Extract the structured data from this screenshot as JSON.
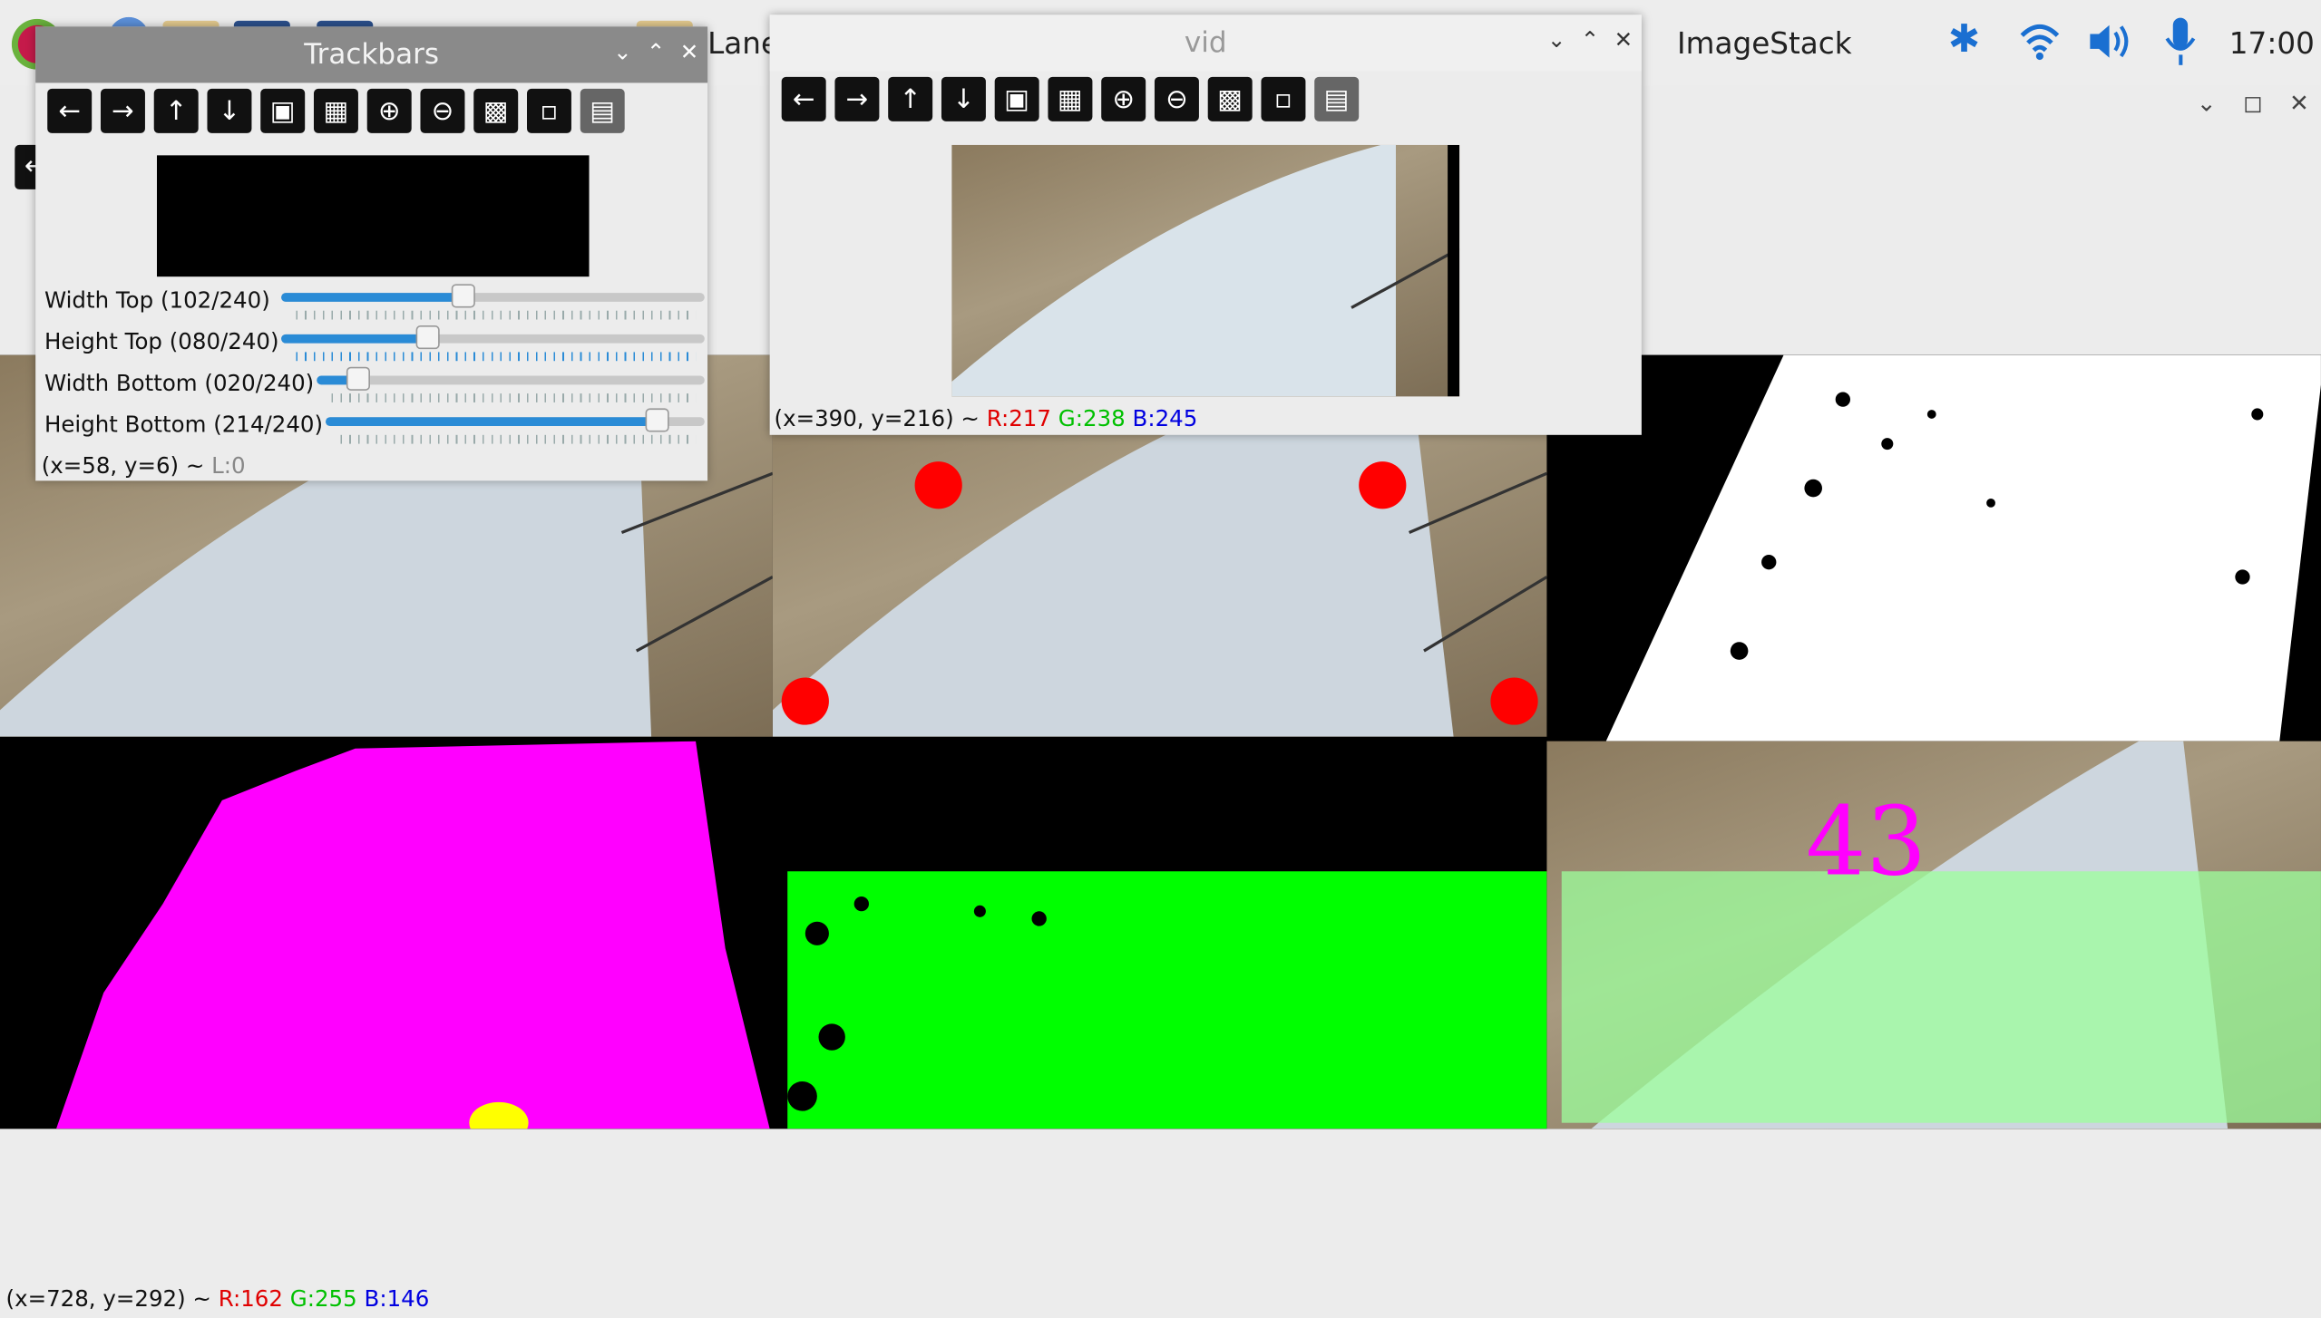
{
  "taskbar": {
    "lane_label": "Lane",
    "imagestack_title": "ImageStack",
    "clock": "17:00"
  },
  "trackbars": {
    "title": "Trackbars",
    "sliders": [
      {
        "label": "Width Top  (102/240)",
        "value": 102,
        "max": 240
      },
      {
        "label": "Height Top (080/240)",
        "value": 80,
        "max": 240
      },
      {
        "label": "Width Bottom (020/240)",
        "value": 20,
        "max": 240
      },
      {
        "label": "Height Bottom (214/240)",
        "value": 214,
        "max": 240
      }
    ],
    "status": "(x=58, y=6) ~ ",
    "status_l": "L:0"
  },
  "vid": {
    "title": "vid",
    "status_xy": "(x=390, y=216) ~ ",
    "r": "R:217",
    "g": "G:238",
    "b": "B:245"
  },
  "imagestack": {
    "overlay_number": "43",
    "status_xy": "(x=728, y=292) ~ ",
    "r": "R:162",
    "g": "G:255",
    "b": "B:146"
  },
  "toolbar_icons": [
    "arrow-left-icon",
    "arrow-right-icon",
    "arrow-up-icon",
    "arrow-down-icon",
    "image-icon",
    "image-zoom-icon",
    "zoom-in-icon",
    "zoom-out-icon",
    "save-icon",
    "clipboard-icon",
    "properties-icon"
  ],
  "colors": {
    "accent": "#2a8bd6",
    "magenta": "#ff00ff",
    "green": "#00ff00",
    "red_dot": "#ff0000",
    "yellow_dot": "#ffff00"
  }
}
